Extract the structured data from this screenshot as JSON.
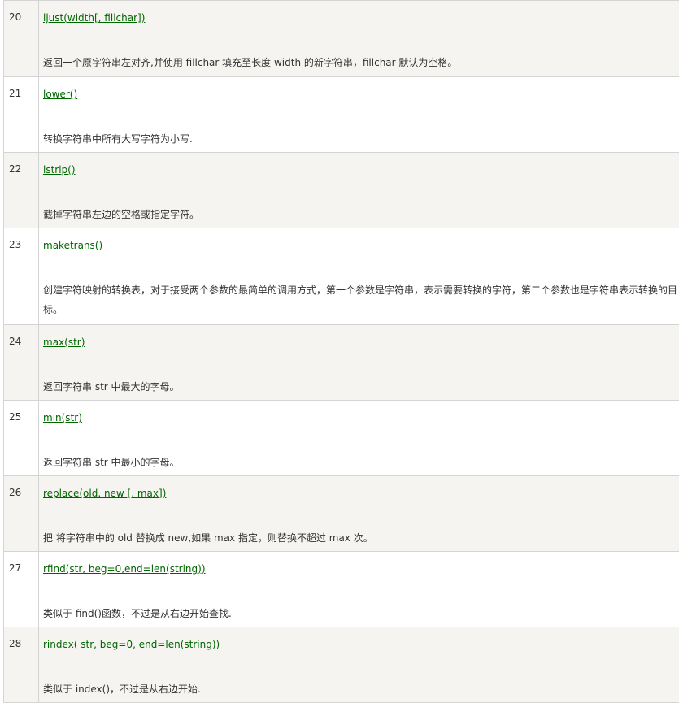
{
  "rows": [
    {
      "num": "20",
      "method": "ljust(width[, fillchar])",
      "desc": "返回一个原字符串左对齐,并使用 fillchar 填充至长度 width 的新字符串，fillchar 默认为空格。"
    },
    {
      "num": "21",
      "method": "lower()",
      "desc": "转换字符串中所有大写字符为小写."
    },
    {
      "num": "22",
      "method": "lstrip()",
      "desc": "截掉字符串左边的空格或指定字符。"
    },
    {
      "num": "23",
      "method": "maketrans()",
      "desc": "创建字符映射的转换表，对于接受两个参数的最简单的调用方式，第一个参数是字符串，表示需要转换的字符，第二个参数也是字符串表示转换的目标。"
    },
    {
      "num": "24",
      "method": "max(str)",
      "desc": "返回字符串 str 中最大的字母。"
    },
    {
      "num": "25",
      "method": "min(str)",
      "desc": "返回字符串 str 中最小的字母。"
    },
    {
      "num": "26",
      "method": "replace(old, new [, max])",
      "desc": "把 将字符串中的 old 替换成 new,如果 max 指定，则替换不超过 max 次。"
    },
    {
      "num": "27",
      "method": "rfind(str, beg=0,end=len(string))",
      "desc": "类似于 find()函数，不过是从右边开始查找."
    },
    {
      "num": "28",
      "method": "rindex( str, beg=0, end=len(string))",
      "desc": "类似于 index()，不过是从右边开始."
    }
  ]
}
